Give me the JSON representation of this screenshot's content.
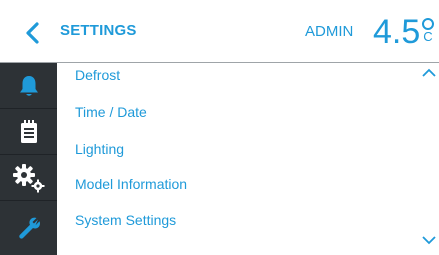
{
  "header": {
    "title": "SETTINGS",
    "user": "ADMIN",
    "temperature": "4.5",
    "unit_letter": "C",
    "back_icon": "chevron-left-icon"
  },
  "sidebar": {
    "items": [
      {
        "icon": "bell-icon"
      },
      {
        "icon": "clipboard-icon"
      },
      {
        "icon": "gears-icon"
      },
      {
        "icon": "wrench-icon"
      }
    ]
  },
  "menu": {
    "items": [
      {
        "label": "Defrost"
      },
      {
        "label": "Time / Date"
      },
      {
        "label": "Lighting"
      },
      {
        "label": "Model Information"
      },
      {
        "label": "System Settings"
      }
    ],
    "scroll_up_icon": "chevron-up-icon",
    "scroll_down_icon": "chevron-down-icon"
  },
  "colors": {
    "accent": "#1f9ad9",
    "sidebar_bg": "#2d3236",
    "icon": "#ffffff"
  }
}
